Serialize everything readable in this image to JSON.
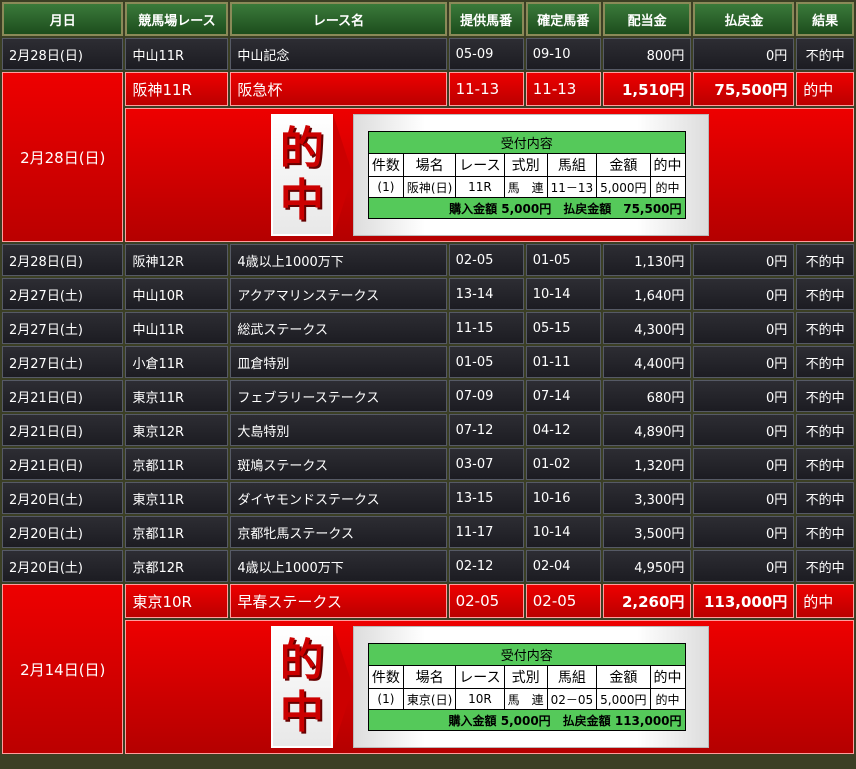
{
  "headers": [
    "月日",
    "競馬場レース",
    "レース名",
    "提供馬番",
    "確定馬番",
    "配当金",
    "払戻金",
    "結果"
  ],
  "rows": [
    {
      "date": "2月28日(日)",
      "venue": "中山11R",
      "race": "中山記念",
      "offered": "05-09",
      "confirmed": "09-10",
      "dividend": "800円",
      "payout": "0円",
      "result": "不的中"
    },
    {
      "date": "2月28日(日)",
      "venue": "阪神11R",
      "race": "阪急杯",
      "offered": "11-13",
      "confirmed": "11-13",
      "dividend": "1,510円",
      "payout": "75,500円",
      "result": "的中"
    },
    {
      "date": "2月28日(日)",
      "venue": "阪神12R",
      "race": "4歳以上1000万下",
      "offered": "02-05",
      "confirmed": "01-05",
      "dividend": "1,130円",
      "payout": "0円",
      "result": "不的中"
    },
    {
      "date": "2月27日(土)",
      "venue": "中山10R",
      "race": "アクアマリンステークス",
      "offered": "13-14",
      "confirmed": "10-14",
      "dividend": "1,640円",
      "payout": "0円",
      "result": "不的中"
    },
    {
      "date": "2月27日(土)",
      "venue": "中山11R",
      "race": "総武ステークス",
      "offered": "11-15",
      "confirmed": "05-15",
      "dividend": "4,300円",
      "payout": "0円",
      "result": "不的中"
    },
    {
      "date": "2月27日(土)",
      "venue": "小倉11R",
      "race": "皿倉特別",
      "offered": "01-05",
      "confirmed": "01-11",
      "dividend": "4,400円",
      "payout": "0円",
      "result": "不的中"
    },
    {
      "date": "2月21日(日)",
      "venue": "東京11R",
      "race": "フェブラリーステークス",
      "offered": "07-09",
      "confirmed": "07-14",
      "dividend": "680円",
      "payout": "0円",
      "result": "不的中"
    },
    {
      "date": "2月21日(日)",
      "venue": "東京12R",
      "race": "大島特別",
      "offered": "07-12",
      "confirmed": "04-12",
      "dividend": "4,890円",
      "payout": "0円",
      "result": "不的中"
    },
    {
      "date": "2月21日(日)",
      "venue": "京都11R",
      "race": "斑鳩ステークス",
      "offered": "03-07",
      "confirmed": "01-02",
      "dividend": "1,320円",
      "payout": "0円",
      "result": "不的中"
    },
    {
      "date": "2月20日(土)",
      "venue": "東京11R",
      "race": "ダイヤモンドステークス",
      "offered": "13-15",
      "confirmed": "10-16",
      "dividend": "3,300円",
      "payout": "0円",
      "result": "不的中"
    },
    {
      "date": "2月20日(土)",
      "venue": "京都11R",
      "race": "京都牝馬ステークス",
      "offered": "11-17",
      "confirmed": "10-14",
      "dividend": "3,500円",
      "payout": "0円",
      "result": "不的中"
    },
    {
      "date": "2月20日(土)",
      "venue": "京都12R",
      "race": "4歳以上1000万下",
      "offered": "02-12",
      "confirmed": "02-04",
      "dividend": "4,950円",
      "payout": "0円",
      "result": "不的中"
    },
    {
      "date": "2月14日(日)",
      "venue": "東京10R",
      "race": "早春ステークス",
      "offered": "02-05",
      "confirmed": "02-05",
      "dividend": "2,260円",
      "payout": "113,000円",
      "result": "的中"
    }
  ],
  "banner": {
    "char1": "的",
    "char2": "中"
  },
  "tickets": [
    {
      "title": "受付内容",
      "cols": [
        "件数",
        "場名",
        "レース",
        "式別",
        "馬組",
        "金額",
        "的中"
      ],
      "values": [
        "(1)",
        "阪神(日)",
        "11R",
        "馬　連",
        "11－13",
        "5,000円",
        "的中"
      ],
      "summary": "購入金額 5,000円　払戻金額　75,500円"
    },
    {
      "title": "受付内容",
      "cols": [
        "件数",
        "場名",
        "レース",
        "式別",
        "馬組",
        "金額",
        "的中"
      ],
      "values": [
        "(1)",
        "東京(日)",
        "10R",
        "馬　連",
        "02－05",
        "5,000円",
        "的中"
      ],
      "summary": "購入金額 5,000円　払戻金額 113,000円"
    }
  ],
  "colors": {
    "hit": "#e00000",
    "header": "#2f6b2f",
    "row": "#24242a",
    "ticketGreen": "#55c95a"
  }
}
